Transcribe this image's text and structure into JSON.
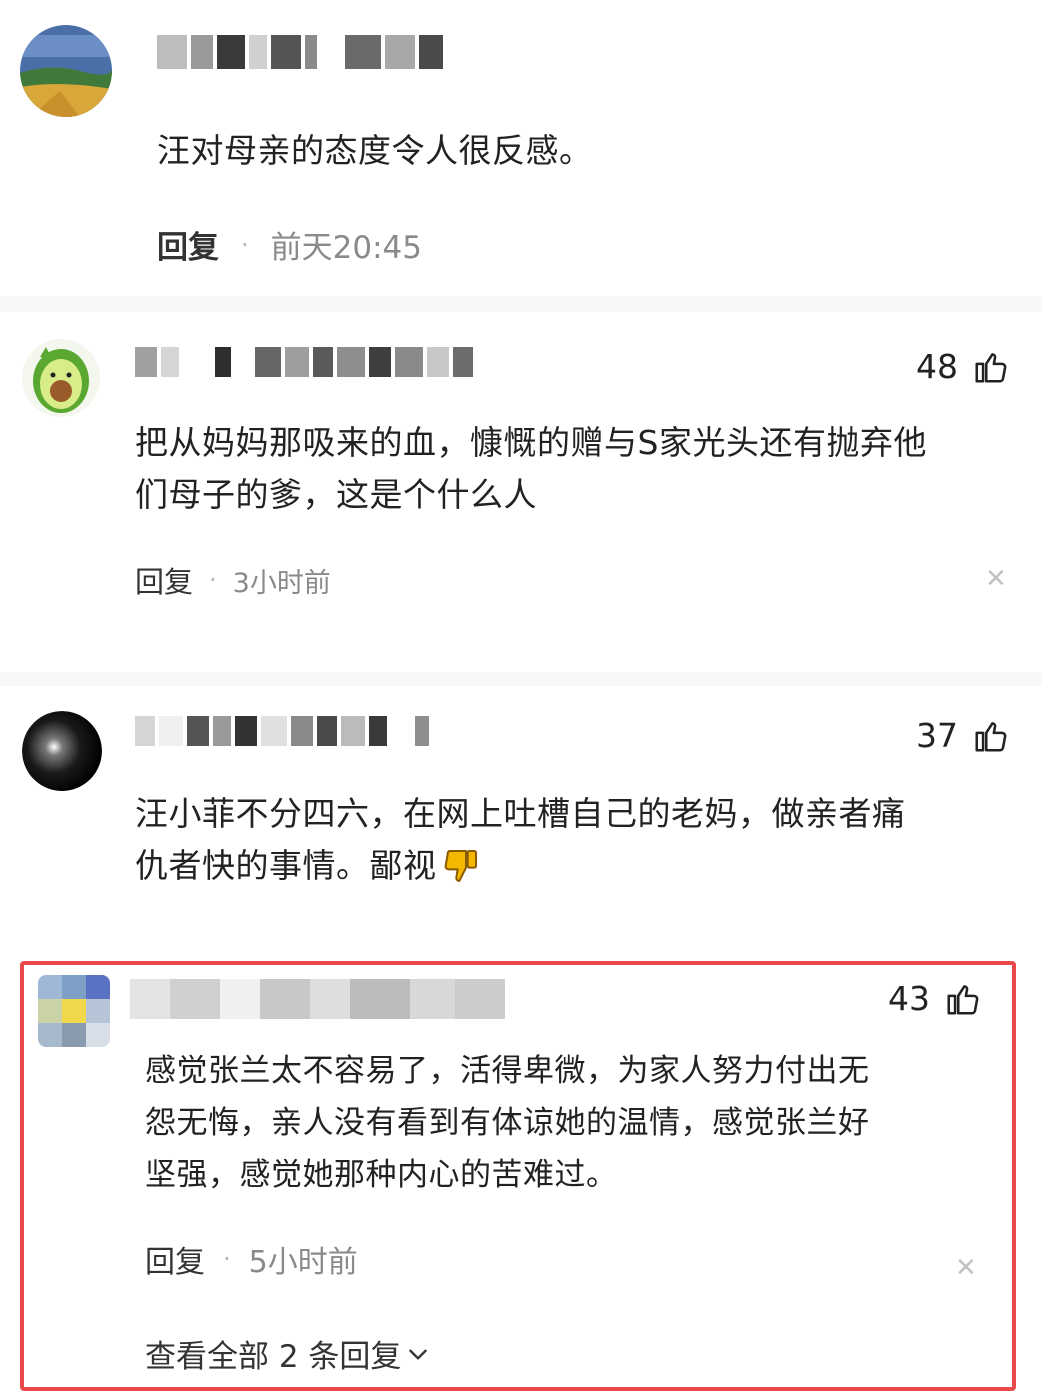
{
  "comments": [
    {
      "text": "汪对母亲的态度令人很反感。",
      "reply_label": "回复",
      "time": "前天20:45",
      "likes": ""
    },
    {
      "text_line1": "把从妈妈那吸来的血，慷慨的赠与S家光头还有抛弃他",
      "text_line2": "们母子的爹，这是个什么人",
      "reply_label": "回复",
      "time": "3小时前",
      "likes": "48"
    },
    {
      "text_line1": "汪小菲不分四六，在网上吐槽自己的老妈，做亲者痛",
      "text_line2": "仇者快的事情。鄙视",
      "likes": "37"
    },
    {
      "text_line1": "感觉张兰太不容易了，活得卑微，为家人努力付出无",
      "text_line2": "怨无悔，亲人没有看到有体谅她的温情，感觉张兰好",
      "text_line3": "坚强，感觉她那种内心的苦难过。",
      "reply_label": "回复",
      "time": "5小时前",
      "likes": "43",
      "view_all_label": "查看全部 2 条回复"
    }
  ],
  "icons": {
    "like": "thumbs-up-icon",
    "close": "close-icon",
    "dislike_emoji": "thumbs-down-icon",
    "chevron": "chevron-down-icon"
  },
  "colors": {
    "highlight_border": "#e94a4a",
    "timestamp": "#8a8a8a",
    "emoji_yellow": "#f5b800"
  }
}
